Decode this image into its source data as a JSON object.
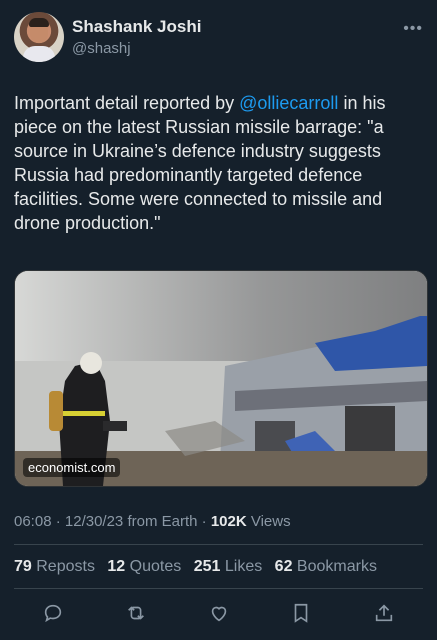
{
  "author": {
    "display_name": "Shashank Joshi",
    "handle": "@shashj"
  },
  "more_icon": "•••",
  "tweet": {
    "text_before": "Important detail reported by ",
    "mention": "@olliecarroll",
    "text_after": " in his piece on the latest Russian missile barrage: \"a source in Ukraine’s defence industry suggests Russia had predominantly targeted defence facilities. Some were connected to missile and drone production.\""
  },
  "media": {
    "badge": "economist.com"
  },
  "meta": {
    "time": "06:08",
    "sep1": " · ",
    "date": "12/30/23",
    "from": " from Earth",
    "sep2": " · ",
    "views_count": "102K",
    "views_label": " Views"
  },
  "stats": [
    {
      "count": "79",
      "label": "Reposts"
    },
    {
      "count": "12",
      "label": "Quotes"
    },
    {
      "count": "251",
      "label": "Likes"
    },
    {
      "count": "62",
      "label": "Bookmarks"
    }
  ],
  "actions": [
    "reply-icon",
    "repost-icon",
    "like-icon",
    "bookmark-icon",
    "share-icon"
  ],
  "colors": {
    "background": "#15202b",
    "text": "#e7e9ea",
    "secondary": "#8b98a5",
    "accent": "#1d9bf0"
  }
}
